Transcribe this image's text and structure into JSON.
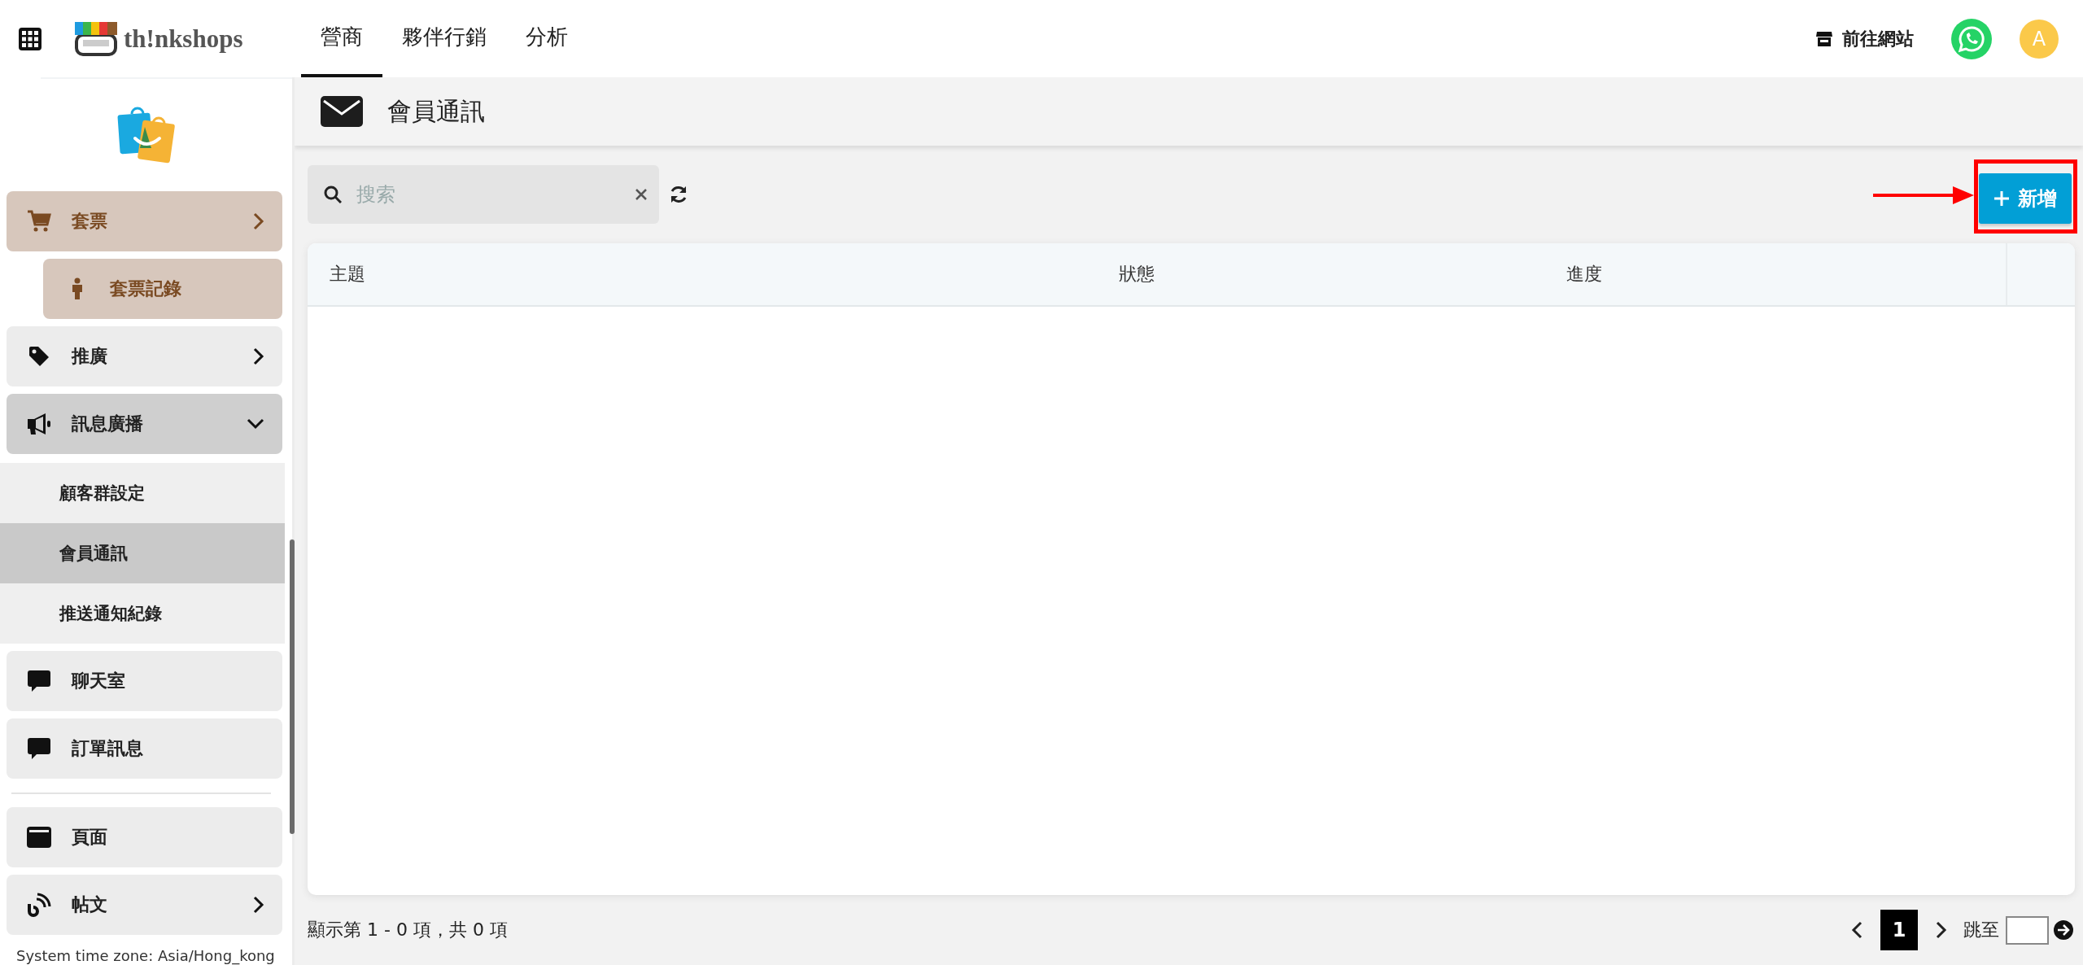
{
  "header": {
    "logo_text": "th!nkshops",
    "tabs": [
      {
        "label": "營商",
        "selected": true
      },
      {
        "label": "夥伴行銷",
        "selected": false
      },
      {
        "label": "分析",
        "selected": false
      }
    ],
    "site_link": "前往網站",
    "avatar": "A"
  },
  "sidebar": {
    "items": [
      {
        "kind": "menu",
        "label": "套票",
        "highlighted": true,
        "expanded": false
      },
      {
        "kind": "sub",
        "label": "套票記錄",
        "highlighted": true
      },
      {
        "kind": "menu",
        "label": "推廣",
        "highlighted": false,
        "expanded": false
      },
      {
        "kind": "menu",
        "label": "訊息廣播",
        "highlighted": false,
        "expanded": true,
        "children": [
          {
            "label": "顧客群設定",
            "selected": false
          },
          {
            "label": "會員通訊",
            "selected": true
          },
          {
            "label": "推送通知紀錄",
            "selected": false
          }
        ]
      },
      {
        "kind": "menu",
        "label": "聊天室",
        "highlighted": false
      },
      {
        "kind": "menu",
        "label": "訂單訊息",
        "highlighted": false
      },
      {
        "kind": "divider"
      },
      {
        "kind": "menu",
        "label": "頁面",
        "highlighted": false
      },
      {
        "kind": "menu",
        "label": "帖文",
        "highlighted": false,
        "expanded": false
      }
    ],
    "timezone": "System time zone: Asia/Hong_kong"
  },
  "page": {
    "title": "會員通訊",
    "search": {
      "placeholder": "搜索"
    },
    "add_button": "新增",
    "table": {
      "columns": [
        "主題",
        "狀態",
        "進度"
      ]
    },
    "footer": {
      "summary": "顯示第 1 - 0 項，共 0 項",
      "pages": [
        {
          "label": "1",
          "selected": true
        }
      ],
      "jump_label": "跳至"
    }
  }
}
